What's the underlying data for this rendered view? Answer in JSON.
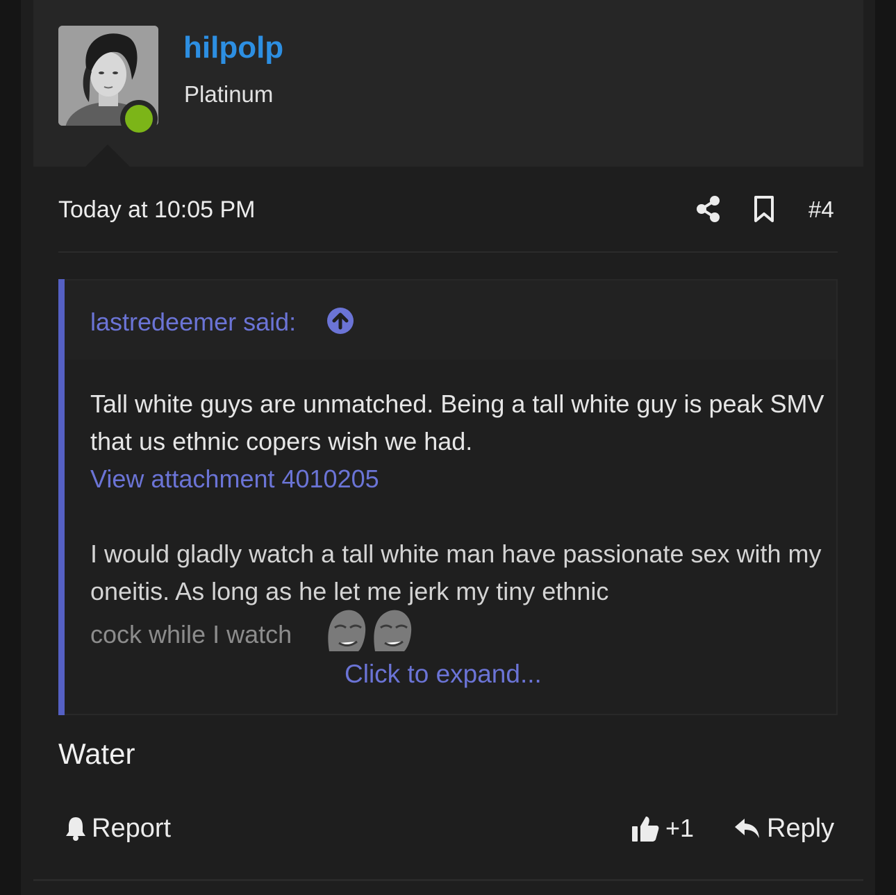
{
  "post": {
    "username": "hilpolp",
    "user_title": "Platinum",
    "date": "Today at 10:05 PM",
    "number": "#4",
    "online": true,
    "body": "Water"
  },
  "quote": {
    "author": "lastredeemer said:",
    "paragraph1": "Tall white guys are unmatched. Being a tall white guy is peak SMV that us ethnic copers wish we had.",
    "attachment_link": "View attachment 4010205",
    "paragraph2": "I would gladly watch a tall white man have passionate sex with my oneitis. As long as he let me jerk my tiny ethnic",
    "faded_line": "cock while I watch",
    "expand_label": "Click to expand..."
  },
  "actions": {
    "report_label": "Report",
    "like_count": "+1",
    "reply_label": "Reply"
  },
  "icons": {
    "share": "share-icon",
    "bookmark": "bookmark-icon",
    "quote_jump": "arrow-up-circle-icon",
    "report": "bell-icon",
    "like": "thumbs-up-icon",
    "reply": "reply-arrow-icon",
    "reaction_emoji": "wojak-face-emoji"
  },
  "colors": {
    "background": "#1e1e1e",
    "username": "#2d8fe2",
    "link": "#6b74d6",
    "quote_bar": "#5560c4",
    "online": "#7cb518"
  }
}
